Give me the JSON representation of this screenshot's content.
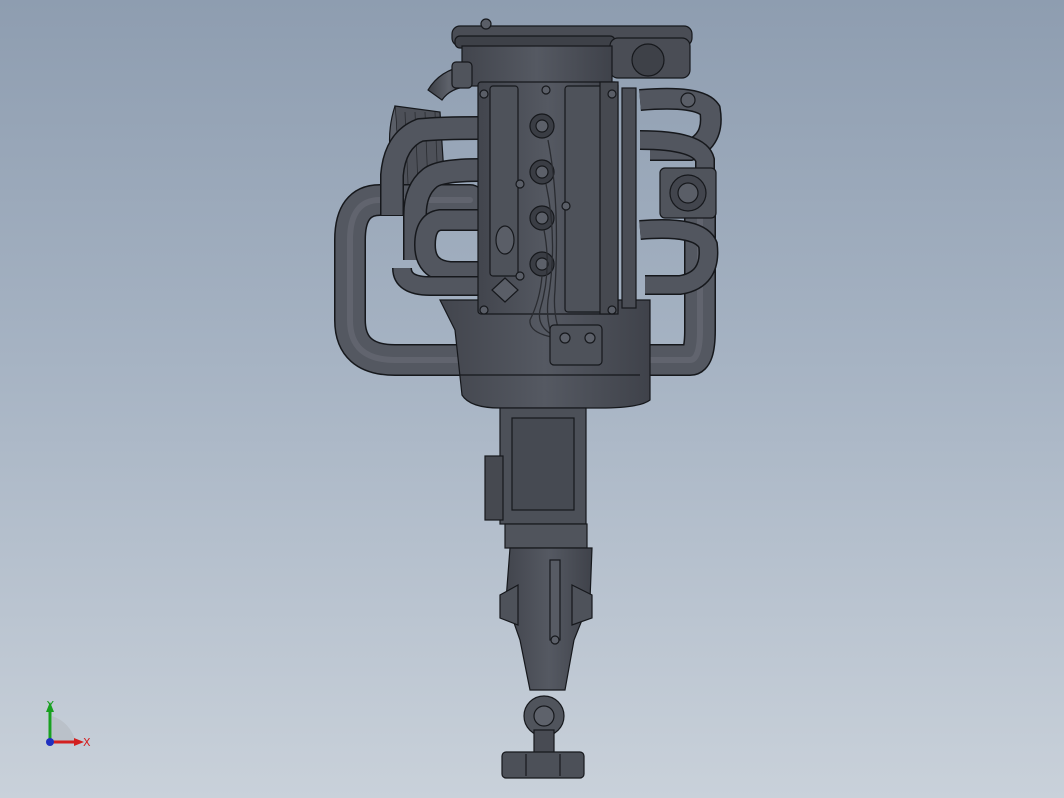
{
  "viewport": {
    "background_top": "#8e9db0",
    "background_bottom": "#c9d1da"
  },
  "model": {
    "description_icon": "engine-gearbox-assembly",
    "body_color": "#4b4f58",
    "edge_color": "#16181c",
    "highlight_color": "#6a6f79"
  },
  "triad": {
    "x_label": "X",
    "y_label": "Y",
    "x_color": "#d32020",
    "y_color": "#18a020",
    "z_color": "#2030c0"
  }
}
